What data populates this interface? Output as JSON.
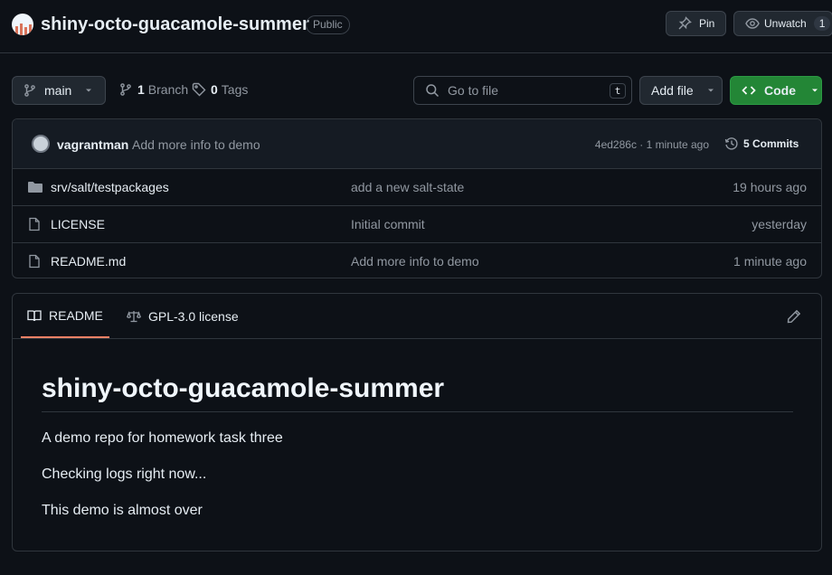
{
  "repo": {
    "name": "shiny-octo-guacamole-summer",
    "visibility": "Public",
    "pin_label": "Pin",
    "watch_label": "Unwatch",
    "watch_count": "1"
  },
  "toolbar": {
    "branch": "main",
    "branches_count": "1",
    "branches_label": "Branch",
    "tags_count": "0",
    "tags_label": "Tags",
    "search_placeholder": "Go to file",
    "search_shortcut": "t",
    "add_file_label": "Add file",
    "code_label": "Code"
  },
  "latest_commit": {
    "author": "vagrantman",
    "message": "Add more info to demo",
    "meta": "4ed286c · 1 minute ago",
    "commits_label": "5 Commits"
  },
  "files": [
    {
      "icon": "folder-icon",
      "name": "srv/salt/testpackages",
      "message": "add a new salt-state",
      "date": "19 hours ago"
    },
    {
      "icon": "file-icon",
      "name": "LICENSE",
      "message": "Initial commit",
      "date": "yesterday"
    },
    {
      "icon": "file-icon",
      "name": "README.md",
      "message": "Add more info to demo",
      "date": "1 minute ago"
    }
  ],
  "readme": {
    "tab_readme": "README",
    "tab_license": "GPL-3.0 license",
    "title": "shiny-octo-guacamole-summer",
    "paragraphs": [
      "A demo repo for homework task three",
      "Checking logs right now...",
      "This demo is almost over"
    ]
  },
  "colors": {
    "background": "#0d1117",
    "border": "#30363d",
    "code_button": "#238636",
    "active_tab_underline": "#f78166",
    "muted_text": "#9198a1"
  }
}
